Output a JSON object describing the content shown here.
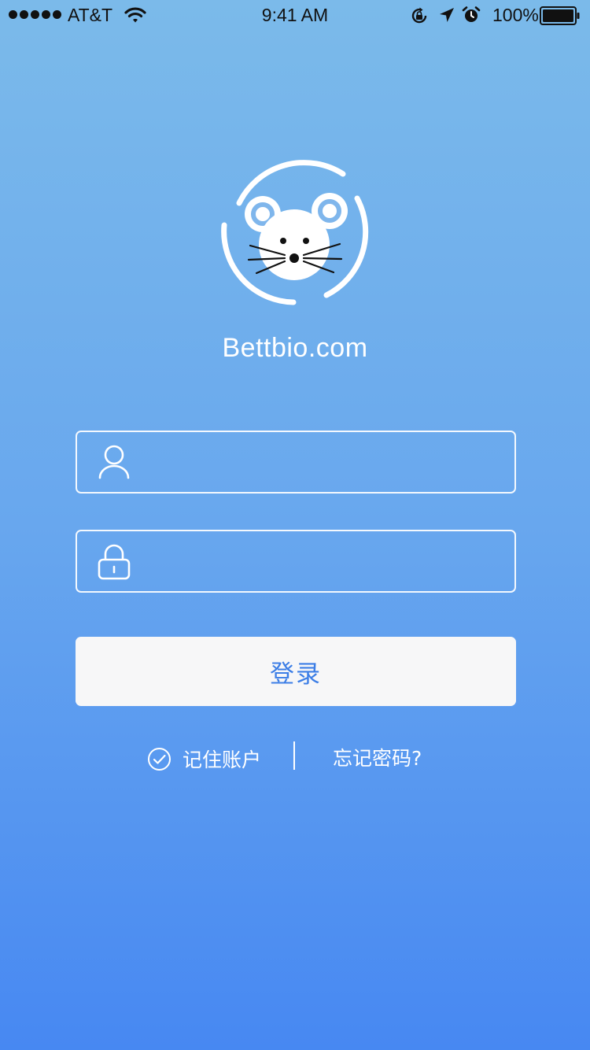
{
  "status_bar": {
    "carrier": "AT&T",
    "time": "9:41 AM",
    "battery": "100%",
    "icons": [
      "signal-dots-icon",
      "wifi-icon",
      "rotation-lock-icon",
      "location-arrow-icon",
      "alarm-clock-icon",
      "battery-icon"
    ]
  },
  "brand": {
    "logo": "mouse-logo-icon",
    "site_name": "Bettbio.com"
  },
  "form": {
    "username": {
      "icon": "user-icon",
      "value": "",
      "placeholder": ""
    },
    "password": {
      "icon": "lock-icon",
      "value": "",
      "placeholder": ""
    },
    "login_label": "登录"
  },
  "options": {
    "remember_label": "记住账户",
    "remember_icon": "check-circle-icon",
    "remember_checked": true,
    "forgot_label": "忘记密码?"
  },
  "colors": {
    "gradient_top": "#7bbaea",
    "gradient_bottom": "#4788f2",
    "button_text": "#3c7ee6",
    "button_bg": "#f7f7f8"
  }
}
